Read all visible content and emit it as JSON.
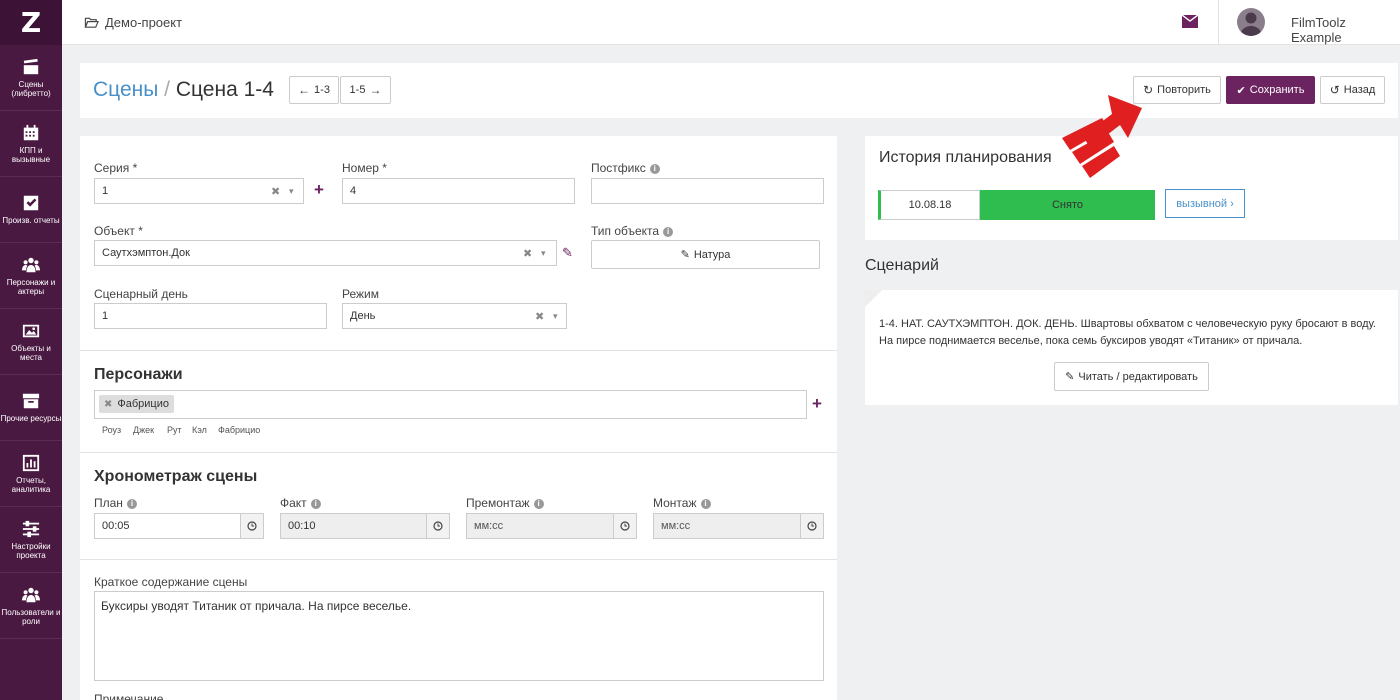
{
  "app": {
    "logo": "Z"
  },
  "sidebar": {
    "items": [
      {
        "label": "Сцены (либретто)",
        "icon": "clapperboard-icon"
      },
      {
        "label": "КПП и вызывные",
        "icon": "calendar-icon"
      },
      {
        "label": "Произв. отчеты",
        "icon": "checkbox-icon"
      },
      {
        "label": "Персонажи и актеры",
        "icon": "users-icon"
      },
      {
        "label": "Объекты и места",
        "icon": "image-icon"
      },
      {
        "label": "Прочие ресурсы",
        "icon": "archive-icon"
      },
      {
        "label": "Отчеты, аналитика",
        "icon": "bar-chart-icon"
      },
      {
        "label": "Настройки проекта",
        "icon": "sliders-icon"
      },
      {
        "label": "Пользователи и роли",
        "icon": "user-group-icon"
      }
    ]
  },
  "topbar": {
    "project": "Демо-проект",
    "username": "FilmToolz Example"
  },
  "header": {
    "crumb_link": "Сцены",
    "crumb_sep": " / ",
    "crumb_current": "Сцена 1-4",
    "prev": "1-3",
    "next": "1-5",
    "repeat": "Повторить",
    "save": "Сохранить",
    "back": "Назад"
  },
  "form": {
    "series": {
      "label": "Серия",
      "value": "1"
    },
    "number": {
      "label": "Номер",
      "value": "4"
    },
    "postfix": {
      "label": "Постфикс",
      "value": ""
    },
    "object": {
      "label": "Объект",
      "value": "Саутхэмптон.Док"
    },
    "object_type": {
      "label": "Тип объекта",
      "value": "Натура"
    },
    "scenario_day": {
      "label": "Сценарный день",
      "value": "1"
    },
    "mode": {
      "label": "Режим",
      "value": "День"
    },
    "required_mark": "*"
  },
  "characters": {
    "title": "Персонажи",
    "selected": [
      "Фабрицио"
    ],
    "suggestions": [
      "Роуз",
      "Джек",
      "Рут",
      "Кэл",
      "Фабрицио"
    ]
  },
  "timing": {
    "title": "Хронометраж сцены",
    "fields": [
      {
        "label": "План",
        "value": "00:05"
      },
      {
        "label": "Факт",
        "value": "00:10"
      },
      {
        "label": "Премонтаж",
        "placeholder": "мм:сс"
      },
      {
        "label": "Монтаж",
        "placeholder": "мм:сс"
      }
    ]
  },
  "summary": {
    "label": "Краткое содержание сцены",
    "value": "Буксиры уводят Титаник от причала. На пирсе веселье."
  },
  "note": {
    "label": "Примечание"
  },
  "history": {
    "title": "История планирования",
    "date": "10.08.18",
    "status": "Снято",
    "call_button": "вызывной"
  },
  "scenario": {
    "title": "Сценарий",
    "line1": "1-4. НАТ. САУТХЭМПТОН. ДОК. ДЕНЬ. Швартовы обхватом с человеческую руку бросают в воду.",
    "line2": "На пирсе поднимается веселье, пока семь буксиров уводят «Титаник» от причала.",
    "edit_button": "Читать / редактировать"
  },
  "colors": {
    "brand": "#4a1942",
    "accent": "#6b2460",
    "success": "#2ebd4e",
    "link": "#4a90c8"
  }
}
